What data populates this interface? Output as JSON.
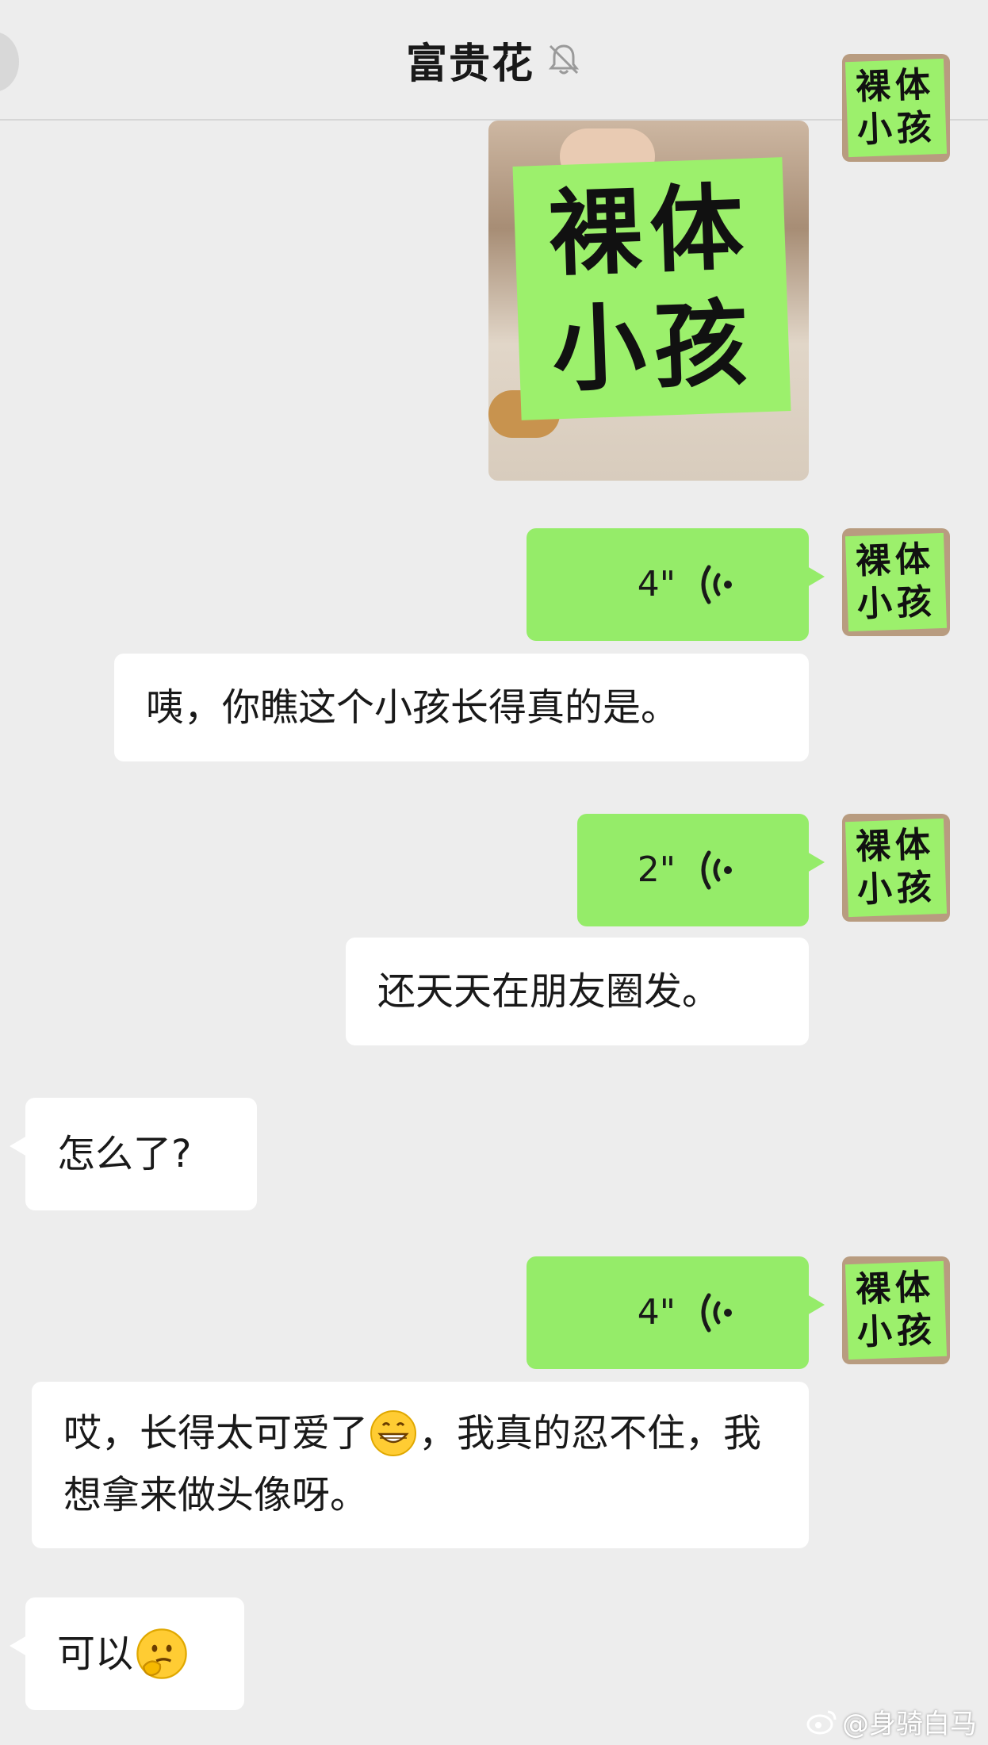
{
  "header": {
    "title": "富贵花",
    "mute_icon": "bell-off-icon",
    "more_icon": "more-dots-icon"
  },
  "colors": {
    "background": "#ededed",
    "sent_bubble": "#95ec69",
    "received_bubble": "#ffffff",
    "sticker_green": "#9cf06c"
  },
  "self_avatar": {
    "line1": "裸体",
    "line2": "小孩"
  },
  "messages": {
    "image": {
      "line1": "裸体",
      "line2": "小孩"
    },
    "voice1": {
      "duration": "4\""
    },
    "msg1": {
      "text": "咦，你瞧这个小孩长得真的是。"
    },
    "voice2": {
      "duration": "2\""
    },
    "msg2": {
      "text": "还天天在朋友圈发。"
    },
    "reply1": {
      "text": "怎么了?"
    },
    "voice3": {
      "duration": "4\""
    },
    "msg3": {
      "part1": "哎，长得太可爱了",
      "part2": "，我真的忍不住，我想拿来做头像呀。",
      "emoji": "grinning-face-emoji"
    },
    "reply2": {
      "text": "可以",
      "emoji": "thinking-face-emoji"
    }
  },
  "watermark": {
    "text": "@身骑白马",
    "icon": "weibo-icon"
  }
}
